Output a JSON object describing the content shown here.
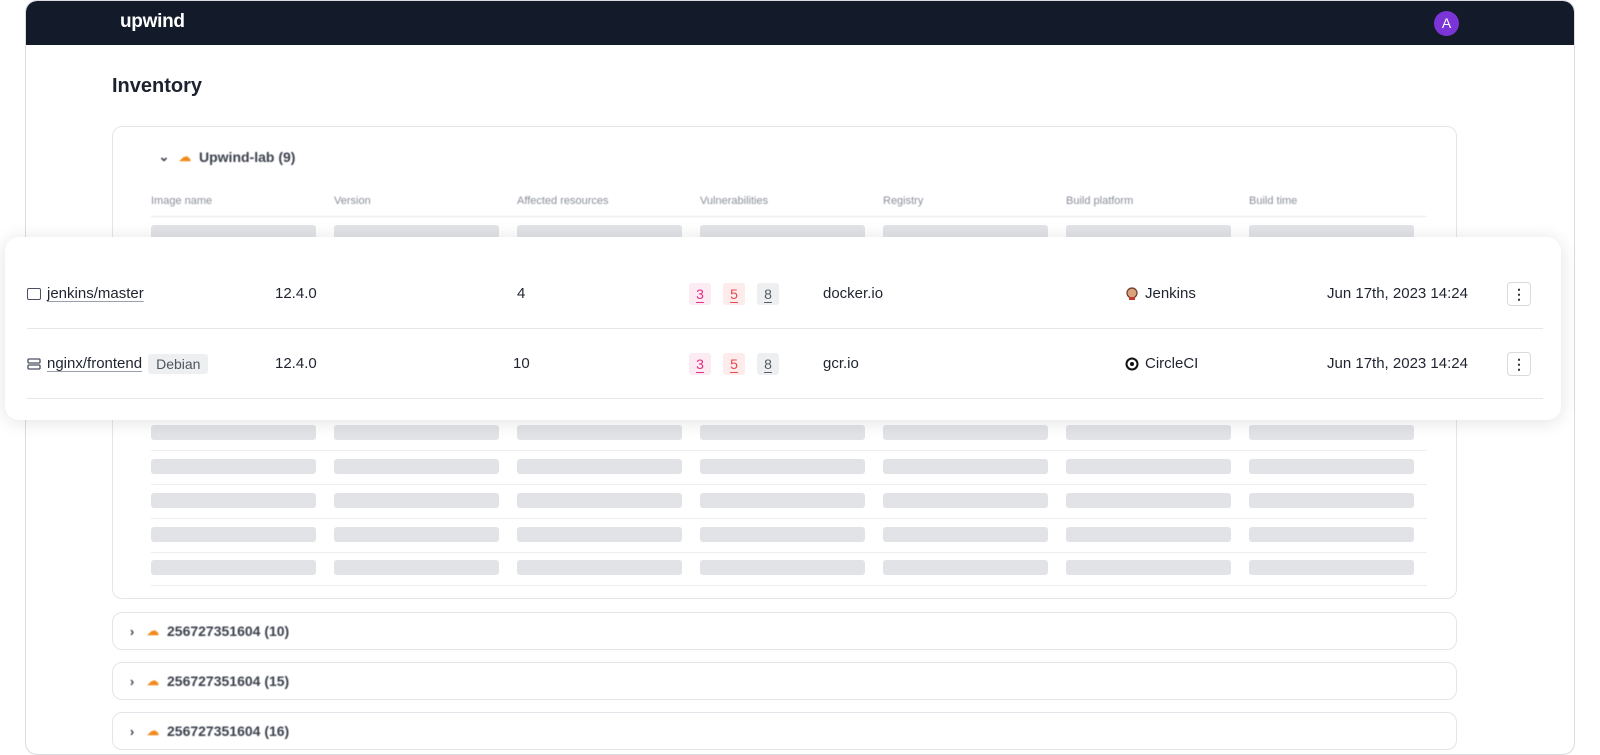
{
  "app": {
    "logo": "upwind",
    "avatar_initial": "A"
  },
  "page": {
    "title": "Inventory"
  },
  "groups": [
    {
      "label": "Upwind-lab (9)",
      "expanded": true
    },
    {
      "label": "256727351604 (10)",
      "expanded": false
    },
    {
      "label": "256727351604 (15)",
      "expanded": false
    },
    {
      "label": "256727351604 (16)",
      "expanded": false
    }
  ],
  "table": {
    "columns": [
      "Image name",
      "Version",
      "Affected resources",
      "Vulnerabilities",
      "Registry",
      "Build platform",
      "Build time"
    ],
    "rows": [
      {
        "image": "jenkins/master",
        "icon": "container-image-icon",
        "tag": "",
        "version": "12.4.0",
        "affected": "4",
        "vulns": [
          "3",
          "5",
          "8"
        ],
        "registry": "docker.io",
        "platform": "Jenkins",
        "platform_icon": "jenkins-icon",
        "build_time": "Jun 17th, 2023 14:24"
      },
      {
        "image": "nginx/frontend",
        "icon": "server-icon",
        "tag": "Debian",
        "version": "12.4.0",
        "affected": "10",
        "vulns": [
          "3",
          "5",
          "8"
        ],
        "registry": "gcr.io",
        "platform": "CircleCI",
        "platform_icon": "circleci-icon",
        "build_time": "Jun 17th, 2023 14:24"
      }
    ]
  },
  "colors": {
    "topbar": "#131a2a",
    "avatar": "#7b35d6",
    "cloud": "#f08a1c",
    "critical": "#e02e86",
    "high": "#e5484d"
  }
}
